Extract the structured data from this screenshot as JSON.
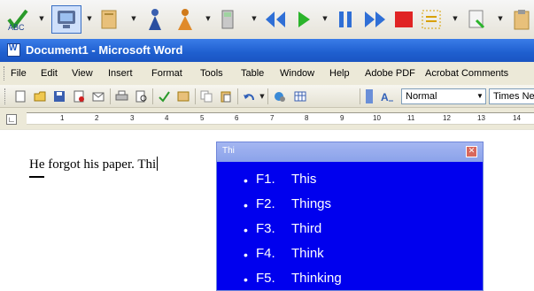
{
  "assist_toolbar": {
    "icons": [
      "abc-check-icon",
      "monitor-icon",
      "book-icon",
      "person-blue-icon",
      "person-orange-icon",
      "calculator-icon",
      "rewind-icon",
      "play-icon",
      "pause-icon",
      "fast-forward-icon",
      "stop-icon",
      "highlight-icon",
      "scan-icon",
      "clipboard-icon"
    ],
    "colors": {
      "play": "#2bb42b",
      "rewind": "#2f6fd6",
      "stop": "#e02424"
    }
  },
  "title_bar": {
    "title": "Document1 - Microsoft Word"
  },
  "menu": {
    "items": [
      "File",
      "Edit",
      "View",
      "Insert",
      "Format",
      "Tools",
      "Table",
      "Window",
      "Help",
      "Adobe PDF",
      "Acrobat Comments"
    ]
  },
  "standard_toolbar": {
    "style_value": "Normal",
    "font_value": "Times New"
  },
  "ruler": {
    "labels": [
      "1",
      "2",
      "3",
      "4",
      "5",
      "6",
      "7",
      "8",
      "9",
      "10",
      "11",
      "12",
      "13",
      "14"
    ]
  },
  "document": {
    "text": "He forgot his paper. Thi"
  },
  "prediction_popup": {
    "title": "Thi",
    "close_label": "✕",
    "background": "#0000ee",
    "suggestions": [
      {
        "key": "F1.",
        "word": "This"
      },
      {
        "key": "F2.",
        "word": "Things"
      },
      {
        "key": "F3.",
        "word": "Third"
      },
      {
        "key": "F4.",
        "word": "Think"
      },
      {
        "key": "F5.",
        "word": "Thinking"
      }
    ]
  }
}
